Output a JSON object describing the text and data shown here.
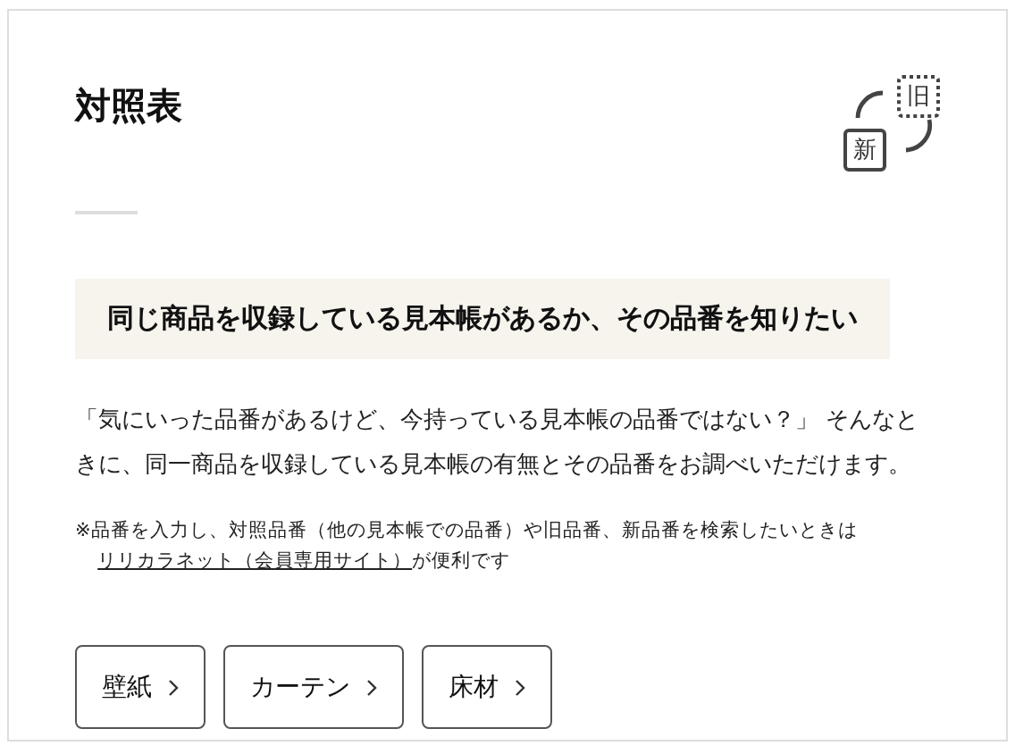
{
  "title": "対照表",
  "badge": {
    "old_label": "旧",
    "new_label": "新"
  },
  "heading": "同じ商品を収録している見本帳があるか、その品番を知りたい",
  "description": "「気にいった品番があるけど、今持っている見本帳の品番ではない？」 そんなときに、同一商品を収録している見本帳の有無とその品番をお調べいただけます。",
  "note": {
    "before": "※品番を入力し、対照品番（他の見本帳での品番）や旧品番、新品番を検索したいときは",
    "link": "リリカラネット（会員専用サイト）",
    "after": "が便利です"
  },
  "buttons": [
    {
      "label": "壁紙"
    },
    {
      "label": "カーテン"
    },
    {
      "label": "床材"
    }
  ]
}
